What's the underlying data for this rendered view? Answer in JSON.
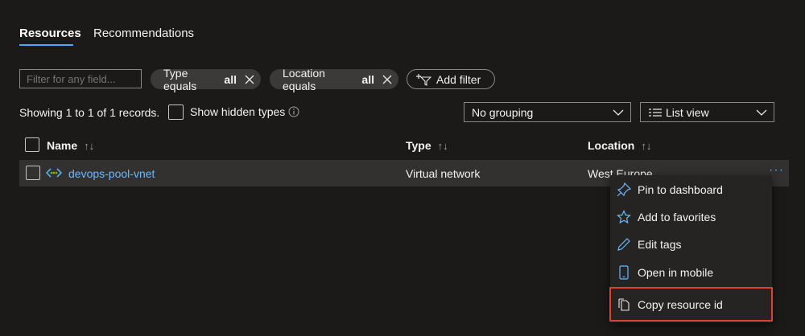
{
  "tabs": [
    {
      "label": "Resources",
      "active": true
    },
    {
      "label": "Recommendations",
      "active": false
    }
  ],
  "filter": {
    "placeholder": "Filter for any field..."
  },
  "pills": [
    {
      "prefix": "Type equals",
      "value": "all"
    },
    {
      "prefix": "Location equals",
      "value": "all"
    }
  ],
  "add_filter_label": "Add filter",
  "records_text": "Showing 1 to 1 of 1 records.",
  "show_hidden_label": "Show hidden types",
  "grouping": {
    "selected": "No grouping"
  },
  "view": {
    "selected": "List view"
  },
  "columns": {
    "name": "Name",
    "type": "Type",
    "location": "Location"
  },
  "rows": [
    {
      "name": "devops-pool-vnet",
      "type": "Virtual network",
      "location": "West Europe"
    }
  ],
  "context_menu": [
    {
      "label": "Pin to dashboard",
      "icon": "pin-icon"
    },
    {
      "label": "Add to favorites",
      "icon": "star-icon"
    },
    {
      "label": "Edit tags",
      "icon": "pencil-icon"
    },
    {
      "label": "Open in mobile",
      "icon": "mobile-icon"
    },
    {
      "label": "Copy resource id",
      "icon": "copy-icon",
      "highlighted": true
    }
  ],
  "colors": {
    "accent": "#4da3ff",
    "highlight": "#e0402f",
    "background": "#1b1a19"
  }
}
